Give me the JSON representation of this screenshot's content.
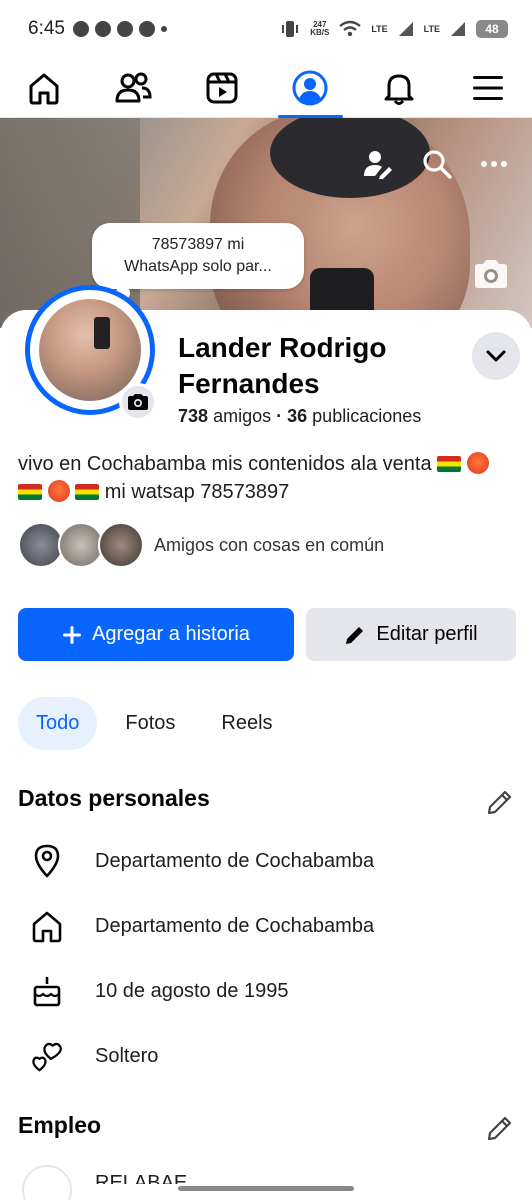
{
  "status_bar": {
    "time": "6:45",
    "net_speed_top": "247",
    "net_speed_unit": "KB/S",
    "lte1": "LTE",
    "lte2": "LTE",
    "battery": "48"
  },
  "nav": {
    "items": [
      {
        "icon": "home-icon",
        "active": false
      },
      {
        "icon": "friends-icon",
        "active": false
      },
      {
        "icon": "video-icon",
        "active": false
      },
      {
        "icon": "profile-icon",
        "active": true
      },
      {
        "icon": "bell-icon",
        "active": false
      },
      {
        "icon": "menu-icon",
        "active": false
      }
    ],
    "accent_color": "#0866ff"
  },
  "cover": {
    "note_bubble": "78573897 mi\nWhatsApp solo par..."
  },
  "profile": {
    "name": "Lander Rodrigo Fernandes",
    "friends_count": "738",
    "friends_label": "amigos",
    "separator": "·",
    "posts_count": "36",
    "posts_label": "publicaciones",
    "bio_part1": "vivo en Cochabamba mis contenidos ala venta",
    "bio_part2": "mi watsap 78573897",
    "mutual_friends_text": "Amigos con cosas en común"
  },
  "buttons": {
    "add_story": "Agregar a historia",
    "edit_profile": "Editar perfil"
  },
  "tabs": [
    {
      "label": "Todo",
      "active": true
    },
    {
      "label": "Fotos",
      "active": false
    },
    {
      "label": "Reels",
      "active": false
    }
  ],
  "personal_details": {
    "title": "Datos personales",
    "items": [
      {
        "icon": "location-pin-icon",
        "text": "Departamento de Cochabamba"
      },
      {
        "icon": "home-icon",
        "text": "Departamento de Cochabamba"
      },
      {
        "icon": "birthday-cake-icon",
        "text": "10 de agosto de 1995"
      },
      {
        "icon": "hearts-icon",
        "text": "Soltero"
      }
    ]
  },
  "employment": {
    "title": "Empleo",
    "peek_text": "RELABAE"
  }
}
